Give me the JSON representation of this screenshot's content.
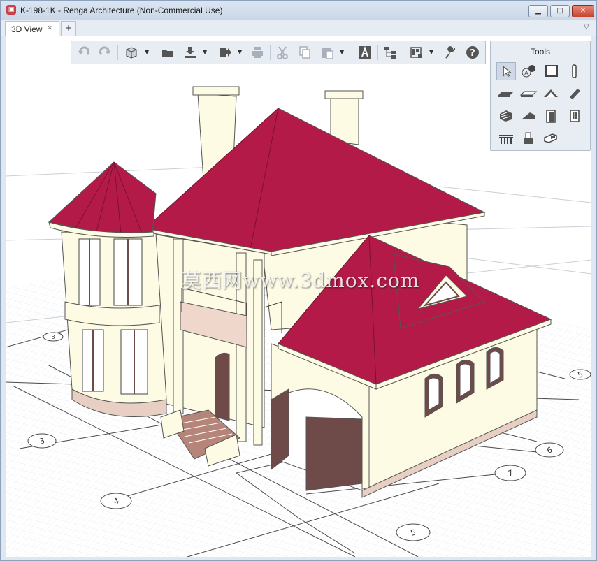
{
  "window": {
    "title": "K-198-1K - Renga Architecture (Non-Commercial Use)",
    "app_icon": "renga-logo-icon",
    "controls": [
      "minimize",
      "maximize",
      "close"
    ]
  },
  "tabs": [
    {
      "label": "3D View",
      "close": "×",
      "active": true
    }
  ],
  "tab_add_label": "+",
  "toolbar": {
    "buttons": [
      "undo-icon",
      "redo-icon",
      "3d-box-icon",
      "folder-open-icon",
      "import-icon",
      "export-icon",
      "print-icon",
      "cut-icon",
      "copy-icon",
      "paste-icon",
      "text-style-icon",
      "structure-icon",
      "view-settings-icon",
      "wrench-icon",
      "help-icon"
    ]
  },
  "tools": {
    "title": "Tools",
    "items": [
      "select",
      "level",
      "wall",
      "column",
      "floor",
      "slab",
      "roof",
      "beam",
      "stair",
      "ramp",
      "door",
      "window",
      "railing",
      "element",
      "opening"
    ],
    "active": "select"
  },
  "grid_axes": {
    "left": [
      "3",
      "4",
      "5"
    ],
    "right": [
      "5",
      "6",
      "7",
      "8"
    ]
  },
  "watermark": "莫西网www.3dmox.com",
  "colors": {
    "roof": "#b41a48",
    "wall": "#fdfbe3",
    "doors": "#6e4b49",
    "base": "#e8cfc4",
    "titlebar": "#d5e0ed"
  }
}
